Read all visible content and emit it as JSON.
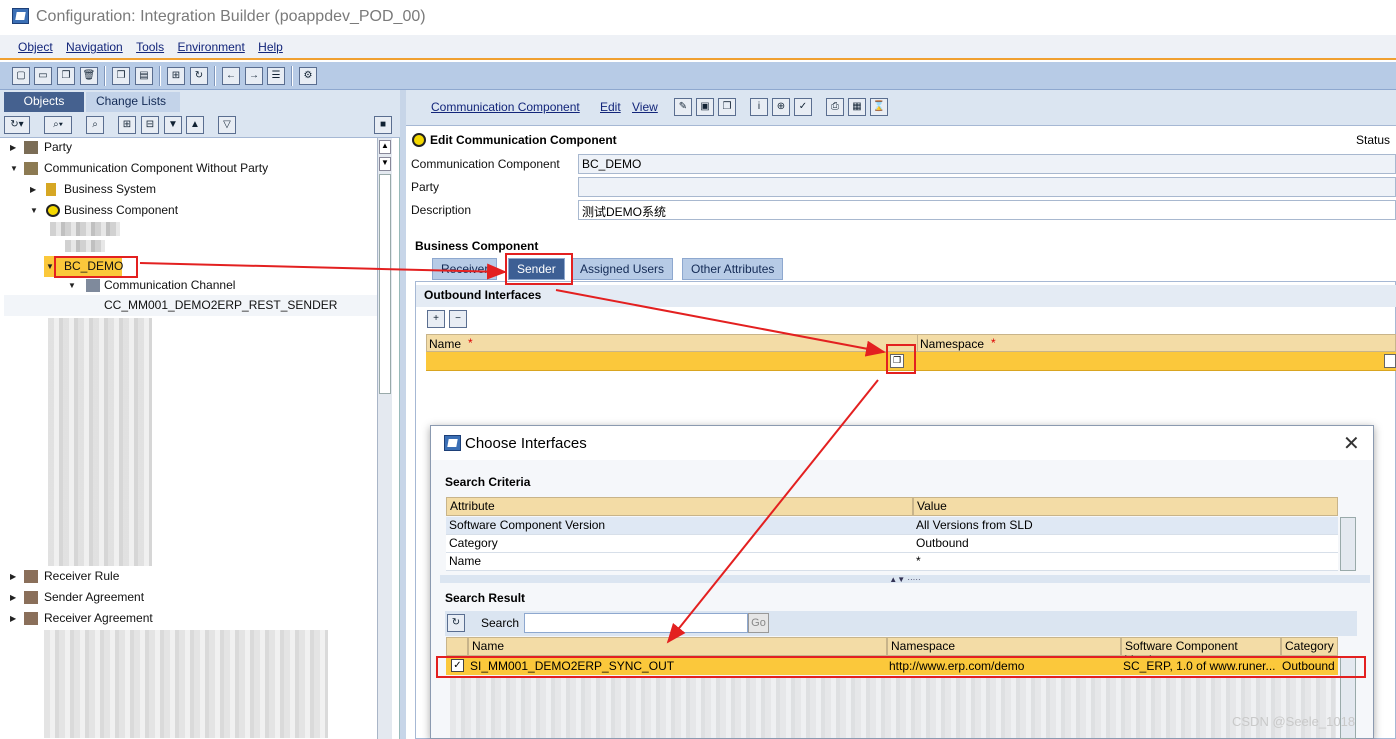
{
  "window": {
    "title": "Configuration: Integration Builder (poappdev_POD_00)"
  },
  "menu": [
    "Object",
    "Navigation",
    "Tools",
    "Environment",
    "Help"
  ],
  "left": {
    "tabs": [
      "Objects",
      "Change Lists"
    ],
    "tree": {
      "party": "Party",
      "ccwp": "Communication Component Without Party",
      "bsys": "Business System",
      "bcomp": "Business Component",
      "bcdemo": "BC_DEMO",
      "cchannel": "Communication Channel",
      "channel": "CC_MM001_DEMO2ERP_REST_SENDER",
      "rrule": "Receiver Rule",
      "sagree": "Sender Agreement",
      "ragree": "Receiver Agreement"
    }
  },
  "right": {
    "toolbar": [
      "Communication Component",
      "Edit",
      "View"
    ],
    "header": "Edit Communication Component",
    "status": "Status",
    "fields": {
      "cc_label": "Communication Component",
      "cc_value": "BC_DEMO",
      "party_label": "Party",
      "party_value": "",
      "desc_label": "Description",
      "desc_value": "测试DEMO系统"
    },
    "section": "Business Component",
    "tabs": [
      "Receiver",
      "Sender",
      "Assigned Users",
      "Other Attributes"
    ],
    "outbound": {
      "title": "Outbound Interfaces",
      "col_name": "Name",
      "col_ns": "Namespace",
      "required": "*"
    }
  },
  "dialog": {
    "title": "Choose Interfaces",
    "criteria_title": "Search Criteria",
    "criteria_cols": [
      "Attribute",
      "Value"
    ],
    "criteria": [
      [
        "Software Component Version",
        "All Versions from SLD"
      ],
      [
        "Category",
        "Outbound"
      ],
      [
        "Name",
        "*"
      ]
    ],
    "result_title": "Search Result",
    "search_label": "Search",
    "search_value": "",
    "go": "Go",
    "result_cols": [
      "Name",
      "Namespace",
      "Software Component Versi...",
      "Category"
    ],
    "result_row": [
      "SI_MM001_DEMO2ERP_SYNC_OUT",
      "http://www.erp.com/demo",
      "SC_ERP, 1.0 of www.runer...",
      "Outbound"
    ]
  },
  "watermark": "CSDN @Seele_1018"
}
